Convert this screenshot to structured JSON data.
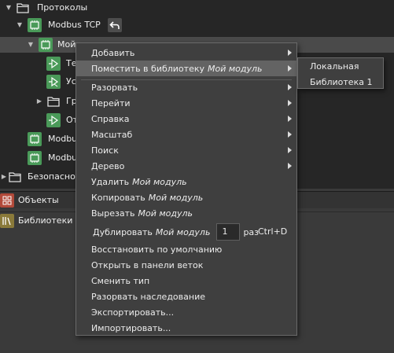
{
  "tree": {
    "protocols_label": "Протоколы",
    "modbus_tcp_1_label": "Modbus TCP",
    "my_module_label": "Мой",
    "child_te_label": "Те",
    "child_us_label": "Ус",
    "child_gr_label": "Гр",
    "child_ot_label": "От",
    "modbus_2_label": "Modbu",
    "modbus_3_label": "Modbu",
    "bezopasnost_label": "Безопасно",
    "objects_label": "Объекты",
    "libraries_label": "Библиотеки"
  },
  "context_menu": {
    "add": "Добавить",
    "place_in_library": "Поместить в библиотеку",
    "place_in_library_target": "Мой модуль",
    "break": "Разорвать",
    "go_to": "Перейти",
    "help": "Справка",
    "scale": "Масштаб",
    "search": "Поиск",
    "tree": "Дерево",
    "delete": "Удалить",
    "delete_target": "Мой модуль",
    "copy": "Копировать",
    "copy_target": "Мой модуль",
    "cut": "Вырезать",
    "cut_target": "Мой модуль",
    "duplicate": "Дублировать",
    "duplicate_target": "Мой модуль",
    "duplicate_count": "1",
    "duplicate_unit": "раз",
    "duplicate_shortcut": "Ctrl+D",
    "restore_default": "Восстановить по умолчанию",
    "open_in_branch_panel": "Открыть в панели веток",
    "change_type": "Сменить тип",
    "break_inheritance": "Разорвать наследование",
    "export": "Экспортировать...",
    "import": "Импортировать..."
  },
  "submenu": {
    "local": "Локальная",
    "library_1": "Библиотека 1"
  },
  "colors": {
    "tree_bg": "#262626",
    "panel_bg": "#3a3a3a",
    "menu_bg": "#3f3f3f",
    "menu_hover": "#636363",
    "icon_green": "#4a9a59"
  }
}
